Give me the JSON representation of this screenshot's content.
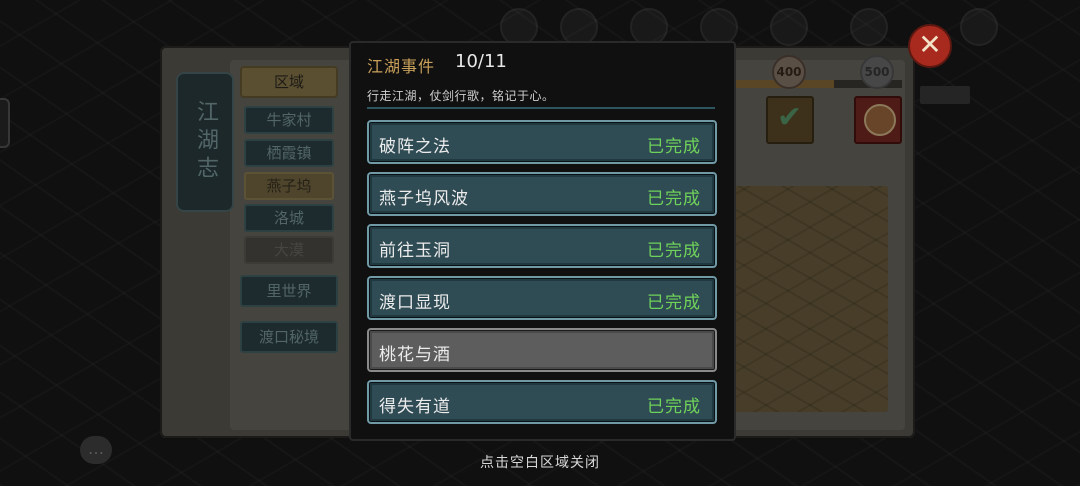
{
  "dialog": {
    "title": "江湖事件",
    "count": "10/11",
    "description": "行走江湖，仗剑行歌，铭记于心。",
    "events": [
      {
        "name": "破阵之法",
        "status": "已完成"
      },
      {
        "name": "燕子坞风波",
        "status": "已完成"
      },
      {
        "name": "前往玉洞",
        "status": "已完成"
      },
      {
        "name": "渡口显现",
        "status": "已完成"
      },
      {
        "name": "桃花与酒",
        "status": ""
      },
      {
        "name": "得失有道",
        "status": "已完成"
      }
    ]
  },
  "sidebar": {
    "title": "江湖志",
    "region_label": "区域",
    "regions": [
      "牛家村",
      "栖霞镇",
      "燕子坞",
      "洛城",
      "大漠"
    ],
    "extra": [
      "里世界",
      "渡口秘境"
    ]
  },
  "milestones": [
    "400",
    "500"
  ],
  "progress_fraction": 0.6,
  "icons": {
    "close": "close-icon",
    "reward_claimed": "check-icon",
    "chat": "chat-bubble-icon"
  },
  "hint": "点击空白区域关闭",
  "colors": {
    "accent_gold": "#c9a15a",
    "completed_green": "#6fd25a",
    "row_teal": "#2f4b54",
    "row_pending": "#5d5d5d",
    "close_red": "#a82a1e"
  }
}
